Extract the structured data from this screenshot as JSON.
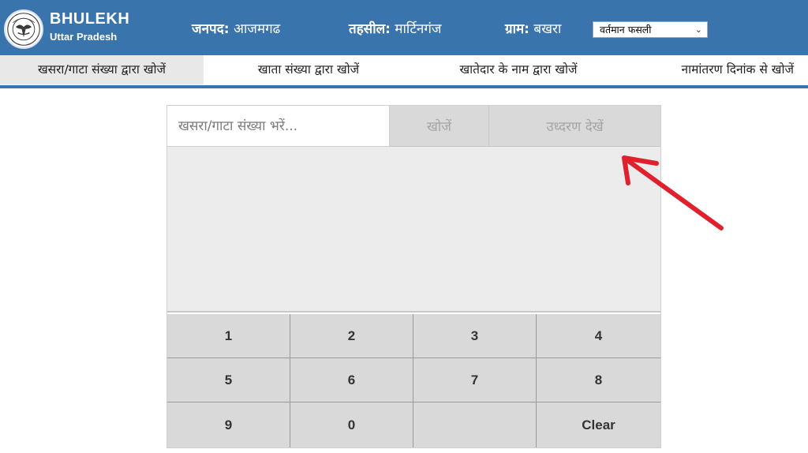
{
  "header": {
    "brand_title": "BHULEKH",
    "brand_subtitle": "Uttar Pradesh",
    "district_label": "जनपद:",
    "district_value": "आजमगढ",
    "tehsil_label": "तहसील:",
    "tehsil_value": "मार्टिनगंज",
    "village_label": "ग्राम:",
    "village_value": "बखरा",
    "fasli_selected": "वर्तमान फसली",
    "colors": {
      "header_bg": "#3a74ad",
      "header_text": "#ffffff"
    }
  },
  "tabs": [
    {
      "label": "खसरा/गाटा संख्या द्वारा खोजें",
      "active": true
    },
    {
      "label": "खाता संख्या द्वारा खोजें",
      "active": false
    },
    {
      "label": "खातेदार के नाम द्वारा खोजें",
      "active": false
    },
    {
      "label": "नामांतरण दिनांक से खोजें",
      "active": false
    }
  ],
  "search": {
    "placeholder": "खसरा/गाटा संख्या भरें...",
    "value": "",
    "search_button": "खोजें",
    "view_button": "उध्दरण देखें"
  },
  "keypad": {
    "keys": [
      "1",
      "2",
      "3",
      "4",
      "5",
      "6",
      "7",
      "8",
      "9",
      "0",
      "",
      "Clear"
    ]
  },
  "annotation": {
    "arrow_color": "#e0202c"
  }
}
